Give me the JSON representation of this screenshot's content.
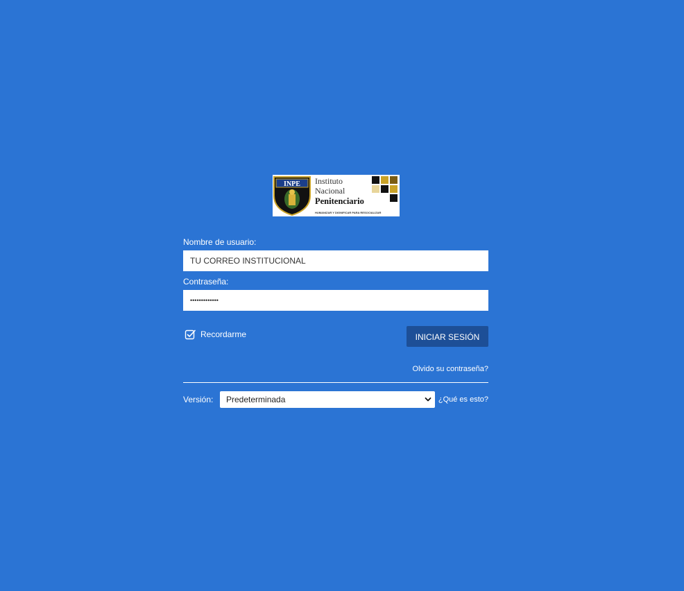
{
  "logo": {
    "acronym": "INPE",
    "line1": "Instituto",
    "line2": "Nacional",
    "line3": "Penitenciario",
    "tagline": "HUMANIZAR Y DIGNIFICAR PARA RESOCIALIZAR"
  },
  "login": {
    "username_label": "Nombre de usuario:",
    "username_value": "TU CORREO INSTITUCIONAL",
    "password_label": "Contraseña:",
    "password_value": "•••••••••••••",
    "remember_label": "Recordarme",
    "remember_checked": true,
    "submit_label": "INICIAR SESIÓN",
    "forgot_link": "Olvido su contraseña?"
  },
  "version": {
    "label": "Versión:",
    "selected": "Predeterminada",
    "help_link": "¿Qué es esto?"
  },
  "colors": {
    "background": "#2b74d4",
    "button": "#1d4f97",
    "logo_gold": "#c9a227"
  },
  "icons": {
    "remember": "checkbox-checked-icon",
    "select": "chevron-down-icon"
  }
}
